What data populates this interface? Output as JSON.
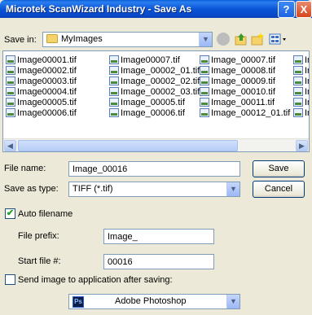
{
  "window": {
    "title": "Microtek ScanWizard Industry - Save As"
  },
  "titlebar_buttons": {
    "help": "?",
    "close": "X"
  },
  "savein": {
    "label": "Save in:",
    "value": "MyImages"
  },
  "files": [
    [
      "Image00001.tif",
      "Image00002.tif",
      "Image00003.tif",
      "Image00004.tif",
      "Image00005.tif",
      "Image00006.tif"
    ],
    [
      "Image00007.tif",
      "Image_00002_01.tif",
      "Image_00002_02.tif",
      "Image_00002_03.tif",
      "Image_00005.tif",
      "Image_00006.tif"
    ],
    [
      "Image_00007.tif",
      "Image_00008.tif",
      "Image_00009.tif",
      "Image_00010.tif",
      "Image_00011.tif",
      "Image_00012_01.tif"
    ],
    [
      "In",
      "In",
      "In",
      "In",
      "In",
      "In"
    ]
  ],
  "form": {
    "filename_label": "File name:",
    "filename_value": "Image_00016",
    "saveas_label": "Save as type:",
    "saveas_value": "TIFF (*.tif)",
    "save_button": "Save",
    "cancel_button": "Cancel",
    "auto_filename_label": "Auto filename",
    "auto_filename_checked": true,
    "prefix_label": "File prefix:",
    "prefix_value": "Image_",
    "startfile_label": "Start file #:",
    "startfile_value": "00016",
    "send_label": "Send image to application after saving:",
    "send_checked": false,
    "app_value": "Adobe Photoshop",
    "app_icon_text": "Ps"
  },
  "colors": {
    "titlebar": "#0a5fd8",
    "face": "#ece9d8",
    "border": "#7f9db9"
  }
}
